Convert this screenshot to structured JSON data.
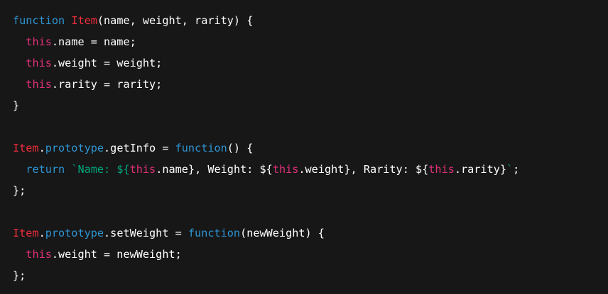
{
  "code": {
    "language": "javascript",
    "lines": [
      [
        {
          "text": "function",
          "kind": "keyword"
        },
        {
          "text": " ",
          "kind": "plain"
        },
        {
          "text": "Item",
          "kind": "class"
        },
        {
          "text": "(name, weight, rarity) {",
          "kind": "plain"
        }
      ],
      [
        {
          "text": "  ",
          "kind": "plain"
        },
        {
          "text": "this",
          "kind": "this"
        },
        {
          "text": ".name = name;",
          "kind": "plain"
        }
      ],
      [
        {
          "text": "  ",
          "kind": "plain"
        },
        {
          "text": "this",
          "kind": "this"
        },
        {
          "text": ".weight = weight;",
          "kind": "plain"
        }
      ],
      [
        {
          "text": "  ",
          "kind": "plain"
        },
        {
          "text": "this",
          "kind": "this"
        },
        {
          "text": ".rarity = rarity;",
          "kind": "plain"
        }
      ],
      [
        {
          "text": "}",
          "kind": "plain"
        }
      ],
      [],
      [
        {
          "text": "Item",
          "kind": "class"
        },
        {
          "text": ".",
          "kind": "plain"
        },
        {
          "text": "prototype",
          "kind": "prop"
        },
        {
          "text": ".getInfo = ",
          "kind": "plain"
        },
        {
          "text": "function",
          "kind": "keyword"
        },
        {
          "text": "() {",
          "kind": "plain"
        }
      ],
      [
        {
          "text": "  ",
          "kind": "plain"
        },
        {
          "text": "return",
          "kind": "keyword"
        },
        {
          "text": " ",
          "kind": "plain"
        },
        {
          "text": "`Name: ${",
          "kind": "string"
        },
        {
          "text": "this",
          "kind": "this"
        },
        {
          "text": ".name}",
          "kind": "plain"
        },
        {
          "text": ", Weight: ${",
          "kind": "plain"
        },
        {
          "text": "this",
          "kind": "this"
        },
        {
          "text": ".weight}",
          "kind": "plain"
        },
        {
          "text": ", Rarity: ${",
          "kind": "plain"
        },
        {
          "text": "this",
          "kind": "this"
        },
        {
          "text": ".rarity}",
          "kind": "plain"
        },
        {
          "text": "`",
          "kind": "string"
        },
        {
          "text": ";",
          "kind": "plain"
        }
      ],
      [
        {
          "text": "};",
          "kind": "plain"
        }
      ],
      [],
      [
        {
          "text": "Item",
          "kind": "class"
        },
        {
          "text": ".",
          "kind": "plain"
        },
        {
          "text": "prototype",
          "kind": "prop"
        },
        {
          "text": ".setWeight = ",
          "kind": "plain"
        },
        {
          "text": "function",
          "kind": "keyword"
        },
        {
          "text": "(newWeight) {",
          "kind": "plain"
        }
      ],
      [
        {
          "text": "  ",
          "kind": "plain"
        },
        {
          "text": "this",
          "kind": "this"
        },
        {
          "text": ".weight = newWeight;",
          "kind": "plain"
        }
      ],
      [
        {
          "text": "};",
          "kind": "plain"
        }
      ]
    ]
  },
  "colors": {
    "background": "#171717",
    "keyword": "#2e95d3",
    "class_name": "#f22c3d",
    "this_keyword": "#df3079",
    "string": "#00a67d",
    "plain": "#ffffff"
  }
}
